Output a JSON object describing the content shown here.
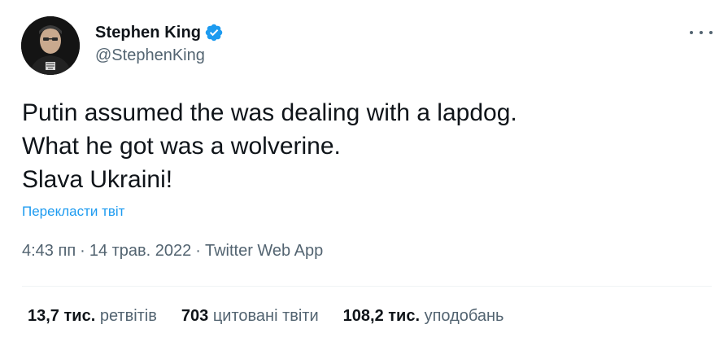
{
  "author": {
    "name": "Stephen King",
    "handle": "@StephenKing",
    "verified": true
  },
  "tweet": {
    "lines": [
      "Putin assumed the was dealing with a lapdog.",
      "What he got was a wolverine.",
      "Slava Ukraini!"
    ],
    "translate_link": "Перекласти твіт",
    "time": "4:43 пп",
    "date": "14 трав. 2022",
    "source": "Twitter Web App",
    "separator": "·"
  },
  "stats": [
    {
      "value": "13,7 тис.",
      "label": "ретвітів"
    },
    {
      "value": "703",
      "label": "цитовані твіти"
    },
    {
      "value": "108,2 тис.",
      "label": "уподобань"
    }
  ],
  "colors": {
    "text": "#0f1419",
    "secondary": "#536471",
    "accent": "#1d9bf0",
    "divider": "#eff3f4"
  },
  "icons": {
    "verified": "verified-badge-icon",
    "more": "more-options-icon"
  }
}
